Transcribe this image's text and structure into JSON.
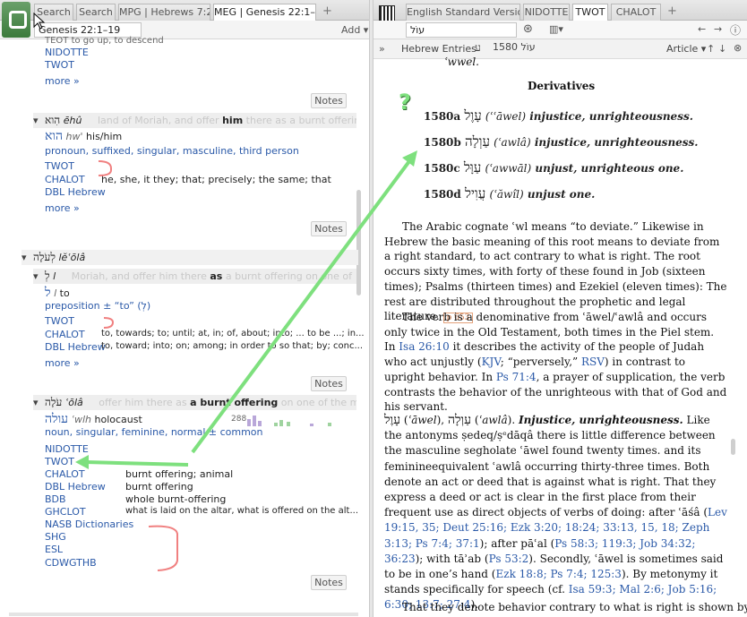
{
  "left": {
    "tabs": [
      {
        "label": "Search"
      },
      {
        "label": "Search"
      },
      {
        "label": "MPG | Hebrews 7:27"
      },
      {
        "label": "MEG | Genesis 22:1–19"
      }
    ],
    "tab_add": "+",
    "reference": "Genesis 22:1–19",
    "add_label": "Add",
    "block1": {
      "top_text": "TEOT    to go up, to descend",
      "links": [
        "NIDOTTE",
        "TWOT"
      ],
      "more": "more »",
      "notes": "Notes"
    },
    "block2": {
      "lemma_heb": "הִוא",
      "lemma_tr": "ēhû",
      "context_ghost": "land of Moriah, and offer",
      "context_bold": "him",
      "context_after": "there as a burnt offering",
      "word_heb": "הוא",
      "word_gloss_tr": "hw'",
      "word_gloss": "his/him",
      "morph": "pronoun, suffixed, singular, masculine, third person",
      "entries": [
        {
          "link": "TWOT",
          "text": ""
        },
        {
          "link": "CHALOT",
          "text": "he, she, it they; that; precisely; the same; that"
        },
        {
          "link": "DBL Hebrew",
          "text": ""
        }
      ],
      "more": "more »",
      "notes": "Notes"
    },
    "block3": {
      "header_heb": "לְעֹלָה",
      "header_tr": "lĕʿōlâ",
      "sub_heb": "לְ",
      "sub_tr": "l",
      "context_ghost": "Moriah, and offer him there",
      "context_bold": "as",
      "context_after": "a burnt offering on one of",
      "word_heb": "ל",
      "word_tr": "l",
      "word_gloss": "to",
      "morph": "preposition ± “to” (לְ)",
      "entries": [
        {
          "link": "TWOT",
          "text": ""
        },
        {
          "link": "CHALOT",
          "text": "to, towards; to; until; at, in; of, about; into; ... to be ...; in..."
        },
        {
          "link": "DBL Hebrew",
          "text": "to, toward; into; on; among; in order to so that; by; conc..."
        }
      ],
      "more": "more »",
      "notes": "Notes"
    },
    "block4": {
      "header_heb": "עֹלָה",
      "header_tr": "ʿōlâ",
      "context_ghost": "offer him there as",
      "context_bold": "a burnt offering",
      "context_after": "on one of the moun",
      "word_heb": "עולה",
      "word_tr": "ʿwlh",
      "word_gloss": "holocaust",
      "count": "288",
      "morph": "noun, singular, feminine, normal ± common",
      "entries": [
        {
          "link": "NIDOTTE",
          "text": ""
        },
        {
          "link": "TWOT",
          "text": ""
        },
        {
          "link": "CHALOT",
          "text": "burnt offering; animal"
        },
        {
          "link": "DBL Hebrew",
          "text": "burnt offering"
        },
        {
          "link": "BDB",
          "text": "whole burnt-offering"
        },
        {
          "link": "GHCLOT",
          "text": "what is laid on the altar, what is offered on the alt..."
        },
        {
          "link": "NASB Dictionaries",
          "text": ""
        },
        {
          "link": "SHG",
          "text": ""
        },
        {
          "link": "ESL",
          "text": ""
        },
        {
          "link": "CDWGTHB",
          "text": ""
        }
      ],
      "notes": "Notes"
    }
  },
  "right": {
    "tabs": [
      {
        "label": "English Standard Version"
      },
      {
        "label": "NIDOTTE"
      },
      {
        "label": "TWOT"
      },
      {
        "label": "CHALOT"
      }
    ],
    "tab_add": "+",
    "search_value": "עוֹל",
    "breadcrumb": [
      "Hebrew Entries",
      "ע",
      "1580 עוֹל"
    ],
    "article_label": "Article",
    "top_cut": "ʿwwel.",
    "derivatives_title": "Derivatives",
    "derivatives": [
      {
        "num": "1580a",
        "heb": "עָוֶל",
        "tr": "ʿāwel",
        "gloss": "injustice, unrighteousness."
      },
      {
        "num": "1580b",
        "heb": "עַוְלָה",
        "tr": "ʿawlâ",
        "gloss": "injustice, unrighteousness."
      },
      {
        "num": "1580c",
        "heb": "עַוָּל",
        "tr": "ʿawwāl",
        "gloss": "unjust, unrighteous one."
      },
      {
        "num": "1580d",
        "heb": "עֲוִיל",
        "tr": "ʿăwîl",
        "gloss": "unjust one."
      }
    ],
    "para1": "The Arabic cognate ʿwl means “to deviate.” Likewise in Hebrew the basic meaning of this root means to deviate from a right standard, to act contrary to what is right. The root occurs sixty times, with forty of these found in Job (sixteen times); Psalms (thirteen times) and Ezekiel (eleven times): The rest are distributed throughout the prophetic and legal literature.",
    "page_tag": "p 653",
    "para2_a": "The verb is a denominative from ʿāwel/ʿawlâ and occurs only twice in the Old Testament, both times in the Piel stem. In",
    "ref_isa": "Isa 26:10",
    "para2_b": "it describes the activity of the people of Judah who act unjustly (",
    "ref_kjv": "KJV",
    "para2_c": "; “perversely,”",
    "ref_rsv": "RSV",
    "para2_d": ") in contrast to upright behavior. In",
    "ref_ps": "Ps 71:4",
    "para2_e": ", a prayer of supplication, the verb contrasts the behavior of the unrighteous with that of God and his servant.",
    "para3_heb1": "עָוֶל",
    "para3_tr1": "ʿāwel",
    "para3_heb2": "עַוְלָה",
    "para3_tr2": "ʿawlâ",
    "para3_title": "Injustice, unrighteousness.",
    "para3_a": "Like the antonyms ṣedeq/ṣᵉdāqâ there is little difference between the masculine segholate ʿāwel found twenty times. and its feminineequivalent ʿawlâ occurring thirty-three times. Both denote an act or deed that is against what is right. That they express a deed or act is clear in the first place from their frequent use as direct objects of verbs of doing: after ʿāśâ (",
    "refs3": "Lev 19:15, 35; Deut 25:16; Ezk 3:20; 18:24; 33:13, 15, 18; Zeph 3:13; Ps 7:4; 37:1",
    "para3_b": "); after pāʿal (",
    "refs4": "Ps 58:3; 119:3; Job 34:32; 36:23",
    "para3_c": "); with tāʾab (",
    "refs5": "Ps 53:2",
    "para3_d": "). Secondly, ʿāwel is sometimes said to be in one’s hand (",
    "refs6": "Ezk 18:8; Ps 7:4; 125:3",
    "para3_e": "). By metonymy it stands specifically for speech (cf.",
    "refs7": "Isa 59:3; Mal 2:6; Job 5:16; 6:30; 13:7; 27:4",
    "para3_f": ").",
    "para4": "That they denote behavior contrary to what is right is shown by"
  },
  "annotations": {
    "question": "?",
    "arrow_color": "#7ee07e",
    "bracket_color": "#f08080"
  }
}
